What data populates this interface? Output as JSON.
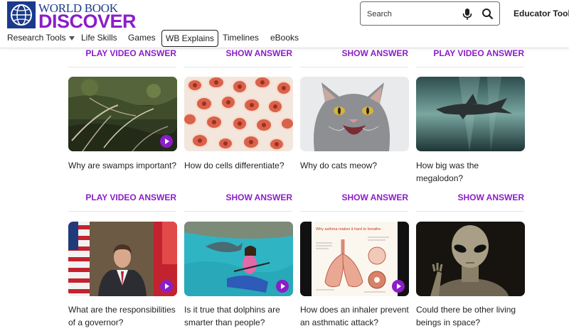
{
  "brand": {
    "top": "WORLD BOOK",
    "bottom": "DISCOVER"
  },
  "search": {
    "placeholder": "Search"
  },
  "header": {
    "educator_tools": "Educator Tools"
  },
  "nav": [
    {
      "label": "Research Tools",
      "selected": false,
      "dropdown": true
    },
    {
      "label": "Life Skills",
      "selected": false
    },
    {
      "label": "Games",
      "selected": false
    },
    {
      "label": "WB Explains",
      "selected": true
    },
    {
      "label": "Timelines",
      "selected": false
    },
    {
      "label": "eBooks",
      "selected": false
    }
  ],
  "top_links": [
    "PLAY VIDEO ANSWER",
    "SHOW ANSWER",
    "SHOW ANSWER",
    "PLAY VIDEO ANSWER"
  ],
  "cards": [
    {
      "title": "Why are swamps important?",
      "link": "PLAY VIDEO ANSWER",
      "video": true,
      "image": "swamp"
    },
    {
      "title": "How do cells differentiate?",
      "link": "SHOW ANSWER",
      "video": false,
      "image": "cells"
    },
    {
      "title": "Why do cats meow?",
      "link": "SHOW ANSWER",
      "video": false,
      "image": "cat"
    },
    {
      "title": "How big was the megalodon?",
      "link": "SHOW ANSWER",
      "video": false,
      "image": "shark"
    },
    {
      "title": "What are the responsibilities of a governor?",
      "link": "",
      "video": true,
      "image": "governor"
    },
    {
      "title": "Is it true that dolphins are smarter than people?",
      "link": "",
      "video": true,
      "image": "dolphin"
    },
    {
      "title": "How does an inhaler prevent an asthmatic attack?",
      "link": "",
      "video": true,
      "image": "lungs"
    },
    {
      "title": "Could there be other living beings in space?",
      "link": "",
      "video": false,
      "image": "alien"
    }
  ],
  "diagram_text": {
    "heading": "Why asthma makes it hard to breathe"
  },
  "colors": {
    "accent": "#8a1ec8",
    "brand_blue": "#1a3a8c",
    "text": "#1f1f1f"
  }
}
